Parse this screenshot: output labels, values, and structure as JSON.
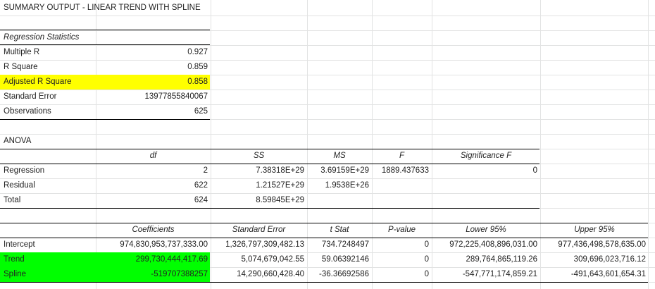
{
  "title": "SUMMARY OUTPUT - LINEAR TREND WITH SPLINE",
  "regression_statistics": {
    "header": "Regression Statistics",
    "rows": [
      {
        "label": "Multiple R",
        "value": "0.927"
      },
      {
        "label": "R Square",
        "value": "0.859"
      },
      {
        "label": "Adjusted R Square",
        "value": "0.858"
      },
      {
        "label": "Standard Error",
        "value": "13977855840067"
      },
      {
        "label": "Observations",
        "value": "625"
      }
    ]
  },
  "anova": {
    "title": "ANOVA",
    "headers": [
      "df",
      "SS",
      "MS",
      "F",
      "Significance F"
    ],
    "rows": [
      {
        "label": "Regression",
        "df": "2",
        "ss": "7.38318E+29",
        "ms": "3.69159E+29",
        "f": "1889.437633",
        "sig": "0"
      },
      {
        "label": "Residual",
        "df": "622",
        "ss": "1.21527E+29",
        "ms": "1.9538E+26",
        "f": "",
        "sig": ""
      },
      {
        "label": "Total",
        "df": "624",
        "ss": "8.59845E+29",
        "ms": "",
        "f": "",
        "sig": ""
      }
    ]
  },
  "coefficients": {
    "headers": [
      "Coefficients",
      "Standard Error",
      "t Stat",
      "P-value",
      "Lower 95%",
      "Upper 95%"
    ],
    "rows": [
      {
        "label": "Intercept",
        "coef": "974,830,953,737,333.00",
        "se": "1,326,797,309,482.13",
        "t": "734.7248497",
        "p": "0",
        "lower": "972,225,408,896,031.00",
        "upper": "977,436,498,578,635.00"
      },
      {
        "label": "Trend",
        "coef": "299,730,444,417.69",
        "se": "5,074,679,042.55",
        "t": "59.06392146",
        "p": "0",
        "lower": "289,764,865,119.26",
        "upper": "309,696,023,716.12"
      },
      {
        "label": "Spline",
        "coef": "-519707388257",
        "se": "14,290,660,428.40",
        "t": "-36.36692586",
        "p": "0",
        "lower": "-547,771,174,859.21",
        "upper": "-491,643,601,654.31"
      }
    ]
  },
  "colors": {
    "highlight_yellow": "#ffff00",
    "highlight_green": "#00ff00",
    "gridline": "#e2e3e3"
  }
}
